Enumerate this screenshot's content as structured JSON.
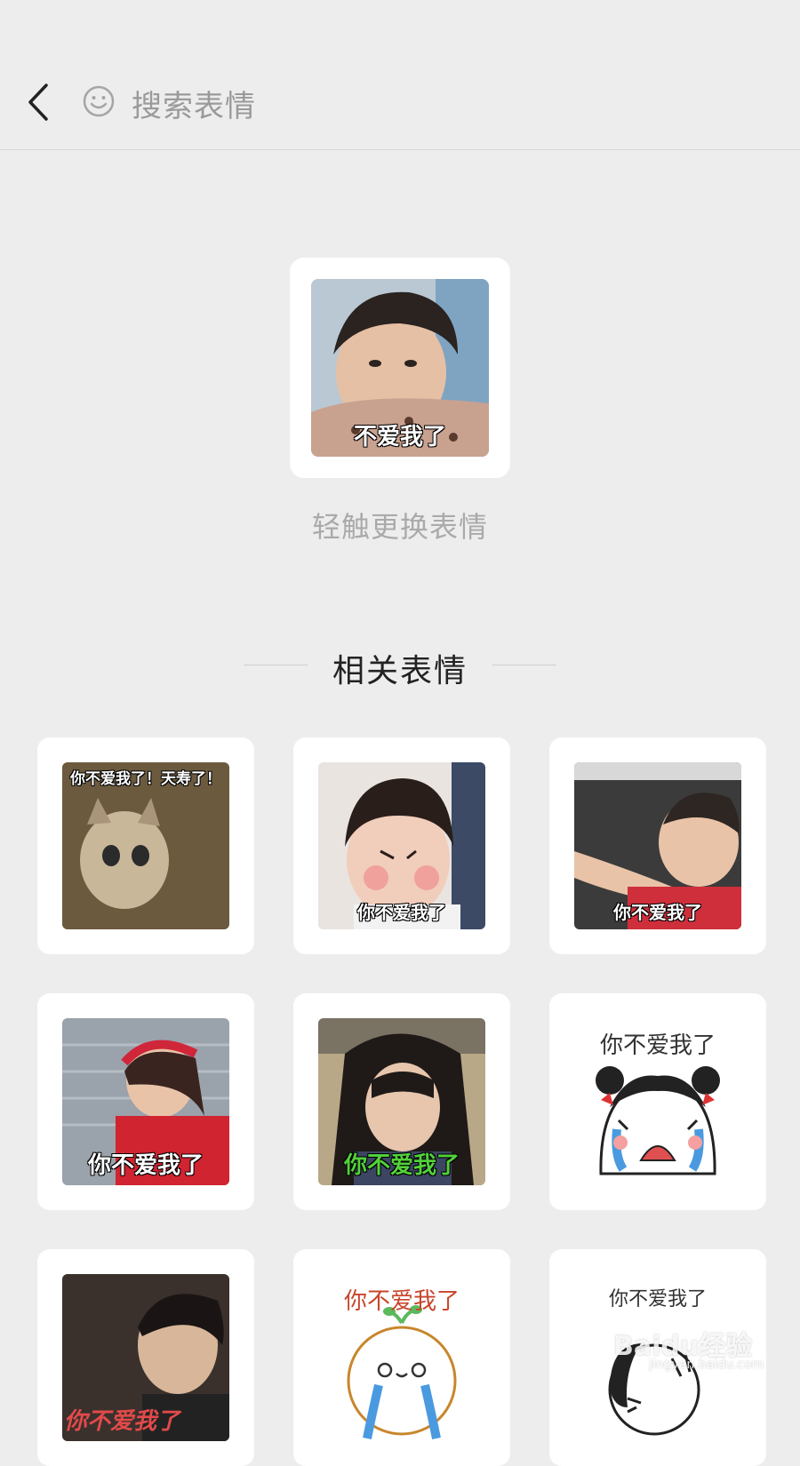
{
  "header": {
    "search_label": "搜索表情"
  },
  "main": {
    "caption": "不爱我了",
    "hint": "轻触更换表情"
  },
  "section": {
    "title": "相关表情"
  },
  "grid": [
    {
      "caption": "你不爱我了！天寿了！"
    },
    {
      "caption": "你不爱我了"
    },
    {
      "caption": "你不爱我了"
    },
    {
      "caption": "你不爱我了"
    },
    {
      "caption": "你不爱我了"
    },
    {
      "caption": "你不爱我了"
    },
    {
      "caption": "你不爱我了"
    },
    {
      "caption": "你不爱我了"
    },
    {
      "caption": "你不爱我了"
    }
  ],
  "watermark": {
    "text": "Baidu经验",
    "sub": "jingyan.baidu.com"
  }
}
